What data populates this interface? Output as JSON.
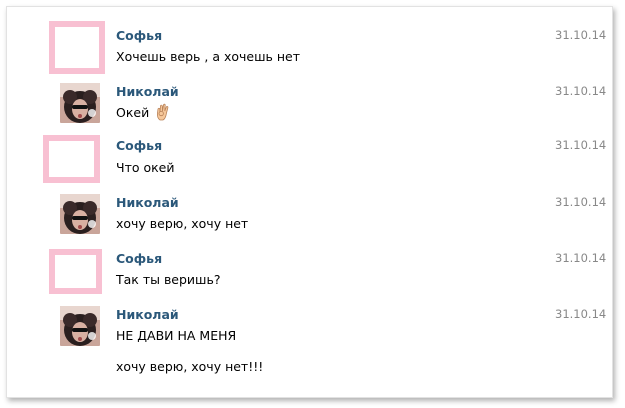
{
  "messages": [
    {
      "author": "Софья",
      "date": "31.10.14",
      "text": "Хочешь верь , а хочешь нет"
    },
    {
      "author": "Николай",
      "date": "31.10.14",
      "text": "Окей",
      "emoji": "ok-hand-emoji"
    },
    {
      "author": "Софья",
      "date": "31.10.14",
      "text": "Что окей"
    },
    {
      "author": "Николай",
      "date": "31.10.14",
      "text": "хочу верю, хочу нет"
    },
    {
      "author": "Софья",
      "date": "31.10.14",
      "text": "Так ты веришь?"
    },
    {
      "author": "Николай",
      "date": "31.10.14",
      "text": "НЕ ДАВИ НА МЕНЯ",
      "text2": "хочу верю, хочу нет!!!"
    }
  ],
  "colors": {
    "author_link": "#2b587a",
    "date": "#888888",
    "avatar_frame": "#f8c0d2"
  }
}
